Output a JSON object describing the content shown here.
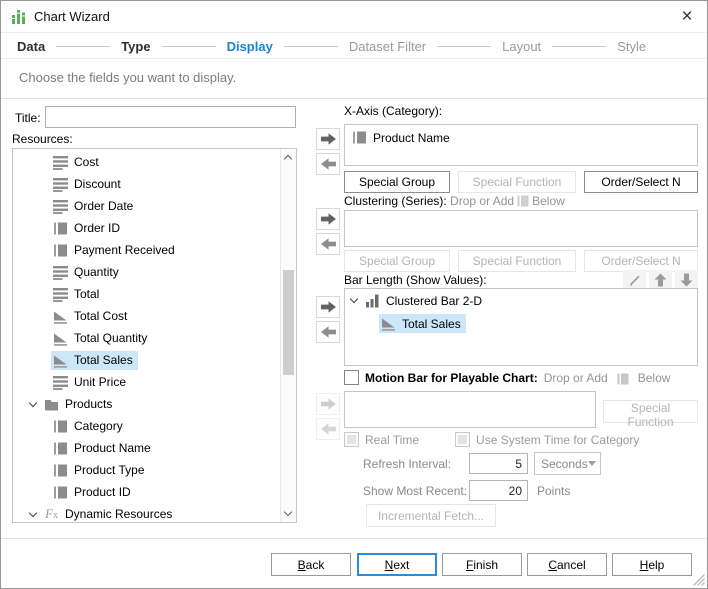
{
  "window": {
    "title": "Chart Wizard",
    "close_glyph": "×"
  },
  "steps": [
    {
      "label": "Data",
      "state": "done"
    },
    {
      "label": "Type",
      "state": "done"
    },
    {
      "label": "Display",
      "state": "active"
    },
    {
      "label": "Dataset Filter",
      "state": "todo"
    },
    {
      "label": "Layout",
      "state": "todo"
    },
    {
      "label": "Style",
      "state": "todo"
    }
  ],
  "subtitle": "Choose the fields you want to display.",
  "left": {
    "title_label": "Title:",
    "title_value": "",
    "resources_label": "Resources:",
    "tree": [
      {
        "label": "Cost",
        "icon": "num-field",
        "type": "field"
      },
      {
        "label": "Discount",
        "icon": "num-field",
        "type": "field"
      },
      {
        "label": "Order Date",
        "icon": "num-field",
        "type": "field"
      },
      {
        "label": "Order ID",
        "icon": "str-field",
        "type": "field"
      },
      {
        "label": "Payment Received",
        "icon": "str-field",
        "type": "field"
      },
      {
        "label": "Quantity",
        "icon": "num-field",
        "type": "field"
      },
      {
        "label": "Total",
        "icon": "num-field",
        "type": "field"
      },
      {
        "label": "Total Cost",
        "icon": "agg-field",
        "type": "field"
      },
      {
        "label": "Total Quantity",
        "icon": "agg-field",
        "type": "field"
      },
      {
        "label": "Total Sales",
        "icon": "agg-field",
        "type": "field",
        "selected": true
      },
      {
        "label": "Unit Price",
        "icon": "num-field",
        "type": "field"
      },
      {
        "label": "Products",
        "icon": "folder",
        "type": "group"
      },
      {
        "label": "Category",
        "icon": "str-field",
        "type": "field"
      },
      {
        "label": "Product Name",
        "icon": "str-field",
        "type": "field"
      },
      {
        "label": "Product Type",
        "icon": "str-field",
        "type": "field"
      },
      {
        "label": "Product ID",
        "icon": "str-field",
        "type": "field"
      },
      {
        "label": "Dynamic Resources",
        "icon": "fx",
        "type": "group"
      }
    ]
  },
  "xaxis": {
    "label": "X-Axis (Category):",
    "items": [
      {
        "label": "Product Name",
        "icon": "str-field"
      }
    ],
    "buttons": [
      {
        "label": "Special Group",
        "enabled": true
      },
      {
        "label": "Special Function",
        "enabled": false
      },
      {
        "label": "Order/Select N",
        "enabled": true
      }
    ]
  },
  "clustering": {
    "label": "Clustering (Series):",
    "hint_prefix": "Drop or Add",
    "hint_suffix": "Below",
    "items": [],
    "buttons": [
      {
        "label": "Special Group",
        "enabled": false
      },
      {
        "label": "Special Function",
        "enabled": false
      },
      {
        "label": "Order/Select N",
        "enabled": false
      }
    ]
  },
  "bar_length": {
    "label": "Bar Length (Show Values):",
    "tools": [
      "edit-pencil",
      "move-up",
      "move-down"
    ],
    "tree": [
      {
        "label": "Clustered Bar 2-D",
        "icon": "chart-bars",
        "chevron": true,
        "level": 0
      },
      {
        "label": "Total Sales",
        "icon": "agg-field",
        "level": 1,
        "selected": true
      }
    ]
  },
  "motion": {
    "label": "Motion Bar for Playable Chart:",
    "hint_prefix": "Drop or Add",
    "hint_suffix": "Below",
    "checked": false,
    "special_function": "Special Function"
  },
  "realtime": {
    "real_time": "Real Time",
    "use_system_time": "Use System Time for Category",
    "refresh_label": "Refresh Interval:",
    "refresh_value": "5",
    "refresh_unit": "Seconds",
    "recent_label": "Show Most Recent:",
    "recent_value": "20",
    "recent_unit": "Points",
    "incremental": "Incremental Fetch..."
  },
  "footer": {
    "buttons": [
      {
        "label": "Back",
        "key": "B",
        "default": false
      },
      {
        "label": "Next",
        "key": "N",
        "default": true
      },
      {
        "label": "Finish",
        "key": "F",
        "default": false
      },
      {
        "label": "Cancel",
        "key": "C",
        "default": false
      },
      {
        "label": "Help",
        "key": "H",
        "default": false
      }
    ]
  },
  "colors": {
    "accent_blue": "#1884d9",
    "selection": "#cbe7f9",
    "icon_gray": "#8c8c8c",
    "logo_green": "#58b158"
  }
}
